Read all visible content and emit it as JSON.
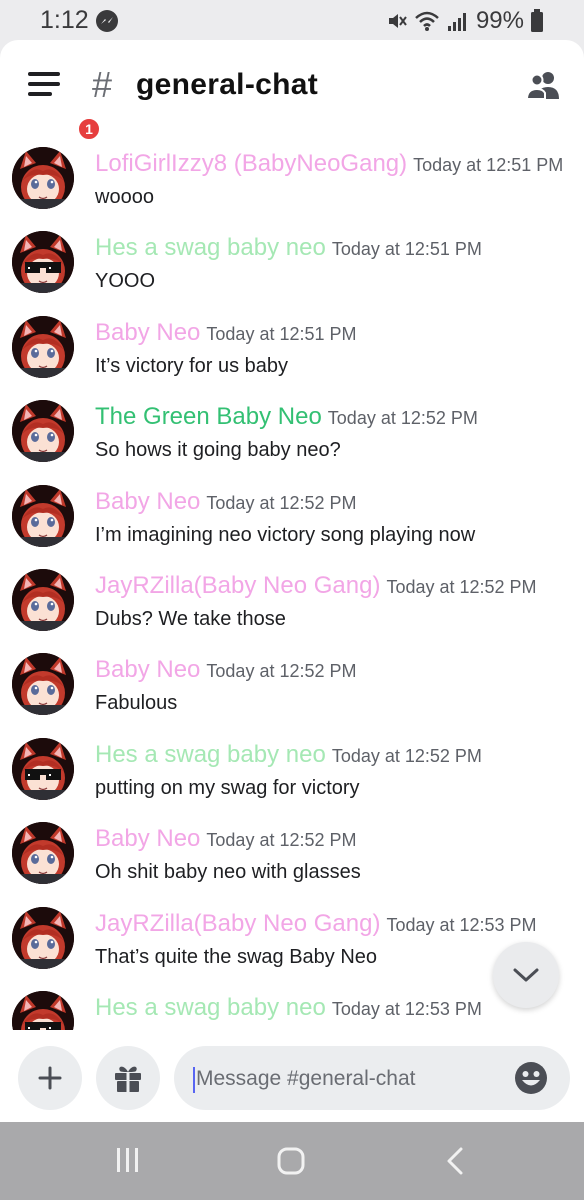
{
  "status_bar": {
    "time": "1:12",
    "battery": "99%"
  },
  "header": {
    "channel_name": "general-chat",
    "menu_badge": "1",
    "hash_symbol": "#"
  },
  "messages": [
    {
      "author": "LofiGirlIzzy8 (BabyNeoGang)",
      "color": "#f2a6e6",
      "timestamp": "Today at 12:51 PM",
      "text": "woooo",
      "avatar": "plain"
    },
    {
      "author": "Hes a swag baby neo",
      "color": "#a5e8b4",
      "timestamp": "Today at 12:51 PM",
      "text": "YOOO",
      "avatar": "glasses"
    },
    {
      "author": "Baby Neo",
      "color": "#f2a6e6",
      "timestamp": "Today at 12:51 PM",
      "text": "It’s victory for us baby",
      "avatar": "plain"
    },
    {
      "author": "The Green Baby Neo",
      "color": "#33c073",
      "timestamp": "Today at 12:52 PM",
      "text": "So hows it going baby neo?",
      "avatar": "plain"
    },
    {
      "author": "Baby Neo",
      "color": "#f2a6e6",
      "timestamp": "Today at 12:52 PM",
      "text": "I’m imagining neo victory song playing now",
      "avatar": "plain"
    },
    {
      "author": "JayRZilla(Baby Neo Gang)",
      "color": "#f2a6e6",
      "timestamp": "Today at 12:52 PM",
      "text": "Dubs? We take those",
      "avatar": "plain"
    },
    {
      "author": "Baby Neo",
      "color": "#f2a6e6",
      "timestamp": "Today at 12:52 PM",
      "text": "Fabulous",
      "avatar": "plain"
    },
    {
      "author": "Hes a swag baby neo",
      "color": "#a5e8b4",
      "timestamp": "Today at 12:52 PM",
      "text": "putting on my swag for victory",
      "avatar": "glasses"
    },
    {
      "author": "Baby Neo",
      "color": "#f2a6e6",
      "timestamp": "Today at 12:52 PM",
      "text": "Oh shit baby neo with glasses",
      "avatar": "plain"
    },
    {
      "author": "JayRZilla(Baby Neo Gang)",
      "color": "#f2a6e6",
      "timestamp": "Today at 12:53 PM",
      "text": "That’s quite the swag Baby Neo",
      "avatar": "plain"
    },
    {
      "author": "Hes a swag baby neo",
      "color": "#a5e8b4",
      "timestamp": "Today at 12:53 PM",
      "text": "",
      "avatar": "glasses"
    }
  ],
  "composer": {
    "placeholder": "Message #general-chat"
  },
  "icons": {
    "menu": "hamburger-icon",
    "members": "members-icon",
    "add": "plus-icon",
    "gift": "gift-icon",
    "emoji": "emoji-icon",
    "scroll": "chevron-down-icon",
    "nav": [
      "recents-icon",
      "home-icon",
      "back-icon"
    ]
  }
}
